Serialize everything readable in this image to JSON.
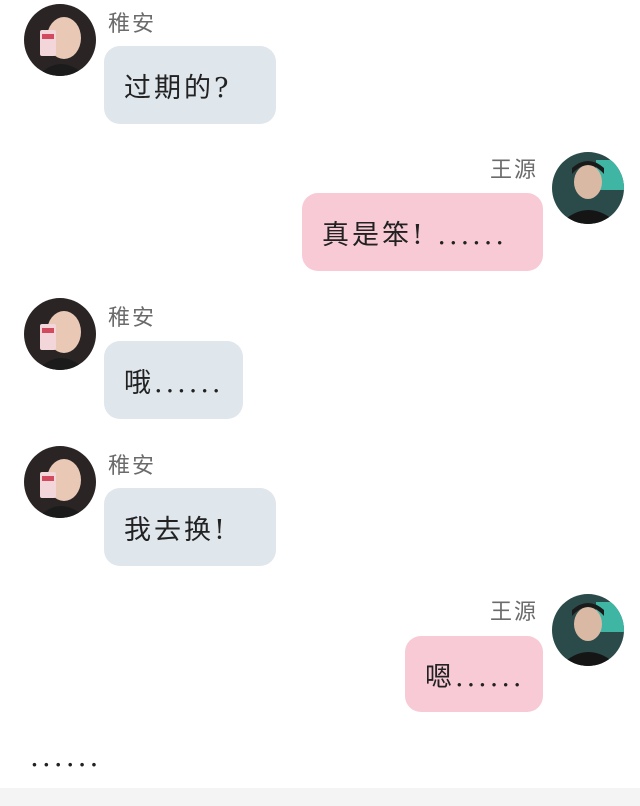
{
  "messages": [
    {
      "side": "left",
      "sender": "稚安",
      "text": "过期的?"
    },
    {
      "side": "right",
      "sender": "王源",
      "text": "真是笨!  ......"
    },
    {
      "side": "left",
      "sender": "稚安",
      "text": "哦......"
    },
    {
      "side": "left",
      "sender": "稚安",
      "text": "我去换!"
    },
    {
      "side": "right",
      "sender": "王源",
      "text": "嗯......"
    }
  ],
  "trailing_text": "......",
  "colors": {
    "left_bubble": "#dfe6ec",
    "right_bubble": "#f8cad5",
    "name": "#6b6b6b"
  },
  "icons": {
    "girl_avatar": "girl-avatar-icon",
    "boy_avatar": "boy-avatar-icon"
  }
}
